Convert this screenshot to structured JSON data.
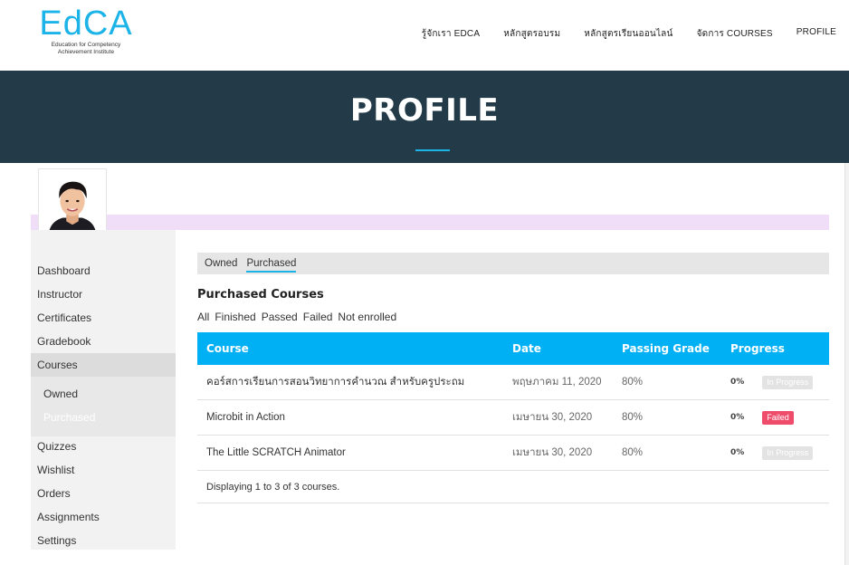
{
  "header": {
    "logo_text": "EdCA",
    "logo_sub_1": "Education for Competency",
    "logo_sub_2": "Achievement Institute",
    "nav": [
      "รู้จักเรา EDCA",
      "หลักสูตรอบรม",
      "หลักสูตรเรียนออนไลน์",
      "จัดการ COURSES",
      "PROFILE"
    ]
  },
  "banner": {
    "title": "PROFILE"
  },
  "sidebar": {
    "items": [
      "Dashboard",
      "Instructor",
      "Certificates",
      "Gradebook",
      "Courses",
      "Quizzes",
      "Wishlist",
      "Orders",
      "Assignments",
      "Settings"
    ],
    "active": "Courses",
    "sub_items": [
      "Owned",
      "Purchased"
    ],
    "active_sub": "Purchased"
  },
  "tabs": {
    "owned": "Owned",
    "purchased": "Purchased"
  },
  "main": {
    "section_title": "Purchased Courses",
    "filters": [
      "All",
      "Finished",
      "Passed",
      "Failed",
      "Not enrolled"
    ],
    "columns": [
      "Course",
      "Date",
      "Passing Grade",
      "Progress"
    ],
    "rows": [
      {
        "course": "คอร์สการเรียนการสอนวิทยาการคำนวณ สำหรับครูประถม",
        "date": "พฤษภาคม 11, 2020",
        "grade": "80%",
        "progress": "0%",
        "status": "In Progress"
      },
      {
        "course": "Microbit in Action",
        "date": "เมษายน 30, 2020",
        "grade": "80%",
        "progress": "0%",
        "status": "Failed"
      },
      {
        "course": "The Little SCRATCH Animator",
        "date": "เมษายน 30, 2020",
        "grade": "80%",
        "progress": "0%",
        "status": "In Progress"
      }
    ],
    "footer": "Displaying 1 to 3 of 3 courses."
  },
  "colors": {
    "brand": "#1bb3e8",
    "banner": "#233b49",
    "table_header": "#00b0f5",
    "failed": "#ef4c6c"
  }
}
